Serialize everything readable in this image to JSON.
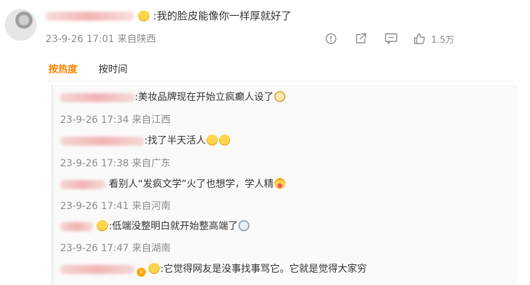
{
  "comment": {
    "text": ":我的脸皮能像你一样厚就好了",
    "time": "23-9-26 17:01",
    "location": "来自陕西",
    "likes": "1.5万"
  },
  "tabs": {
    "hot": "按热度",
    "time": "按时间"
  },
  "replies": [
    {
      "text": ":美妆品牌现在开始立疯癫人设了",
      "emoji": "cat-emoji",
      "time": "23-9-26 17:34",
      "location": "来自江西"
    },
    {
      "text": ":找了半天活人",
      "emoji": "scream-emoji",
      "time": "23-9-26 17:38",
      "location": "来自广东"
    },
    {
      "text": "看别人“发疯文学”火了也想学，学人精",
      "emoji": "tongue-emoji",
      "time": "23-9-26 17:41",
      "location": "来自河南"
    },
    {
      "text": ":低端没整明白就开始整高端了",
      "emoji": "sweat-emoji",
      "time": "23-9-26 17:47",
      "location": "来自湖南"
    },
    {
      "text": ":它觉得网友是没事找事骂它。它就是觉得大家穷",
      "emoji": ""
    }
  ],
  "colors": {
    "accent": "#ff8200",
    "meta": "#8b8b8b"
  }
}
